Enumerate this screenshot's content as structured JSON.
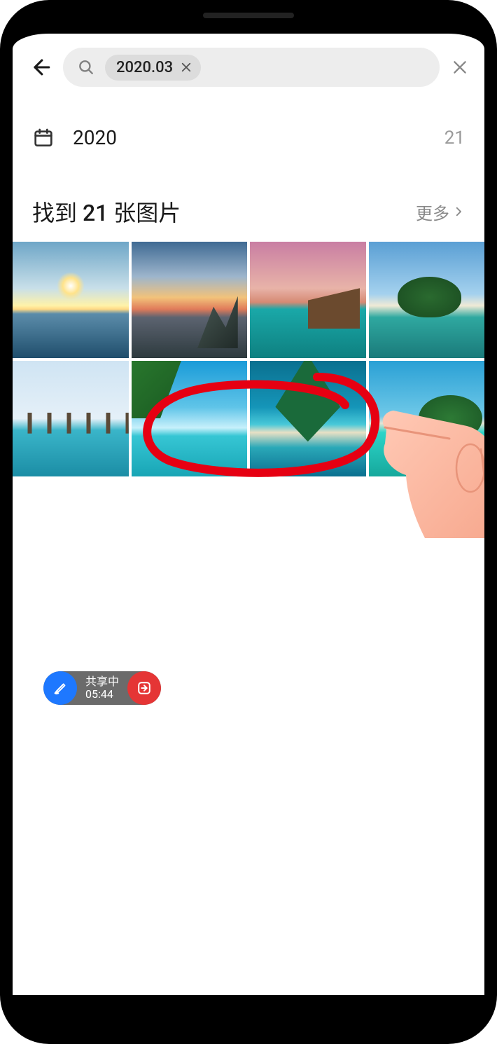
{
  "search": {
    "chip_text": "2020.03",
    "placeholder": ""
  },
  "filter": {
    "year_label": "2020",
    "count": "21"
  },
  "results": {
    "title": "找到 21 张图片",
    "more_label": "更多"
  },
  "share_widget": {
    "status_label": "共享中",
    "timer": "05:44"
  },
  "icons": {
    "back": "back-icon",
    "search": "search-icon",
    "chip_close": "chip-close-icon",
    "clear": "clear-icon",
    "calendar": "calendar-icon",
    "chevron": "chevron-right-icon",
    "edit": "pencil-icon",
    "exit": "exit-icon"
  },
  "thumbnails": [
    {
      "id": "thumb-1"
    },
    {
      "id": "thumb-2"
    },
    {
      "id": "thumb-3"
    },
    {
      "id": "thumb-4"
    },
    {
      "id": "thumb-5"
    },
    {
      "id": "thumb-6"
    },
    {
      "id": "thumb-7"
    },
    {
      "id": "thumb-8"
    }
  ]
}
